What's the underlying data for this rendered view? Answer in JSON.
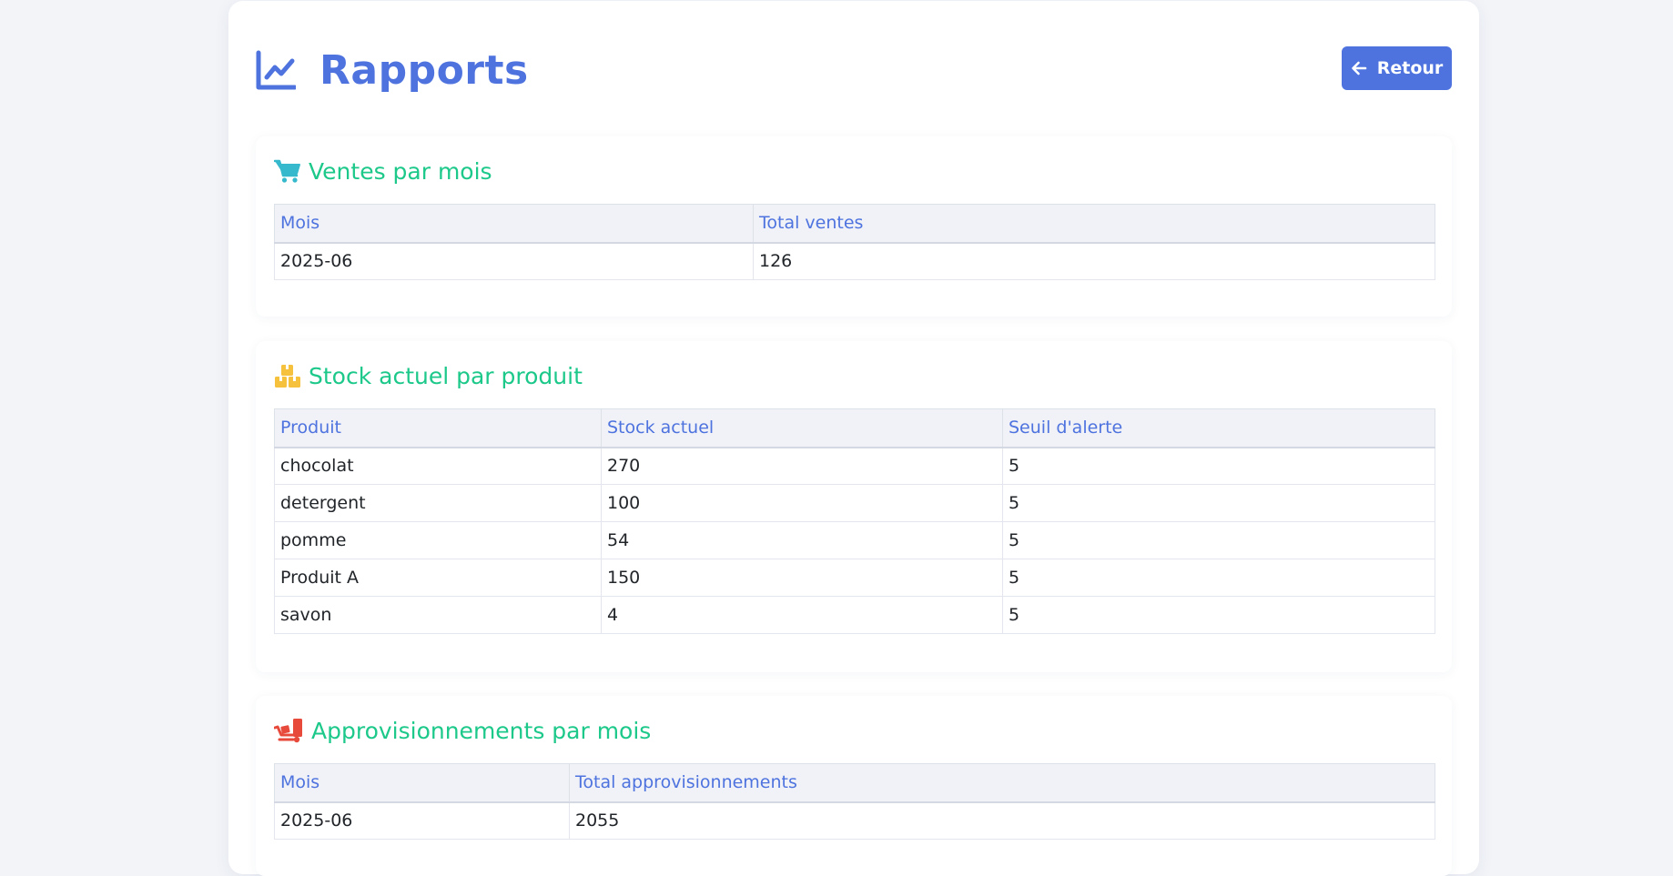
{
  "header": {
    "title": "Rapports",
    "title_icon": "line-chart-icon",
    "back_label": "Retour",
    "back_icon": "arrow-left-icon"
  },
  "colors": {
    "primary": "#4e73df",
    "section_title": "#1cc88a",
    "cart_icon": "#36b9cc",
    "boxes_icon": "#f6c23e",
    "truck_icon": "#e74a3b",
    "background": "#f2f4f8"
  },
  "sales": {
    "title": "Ventes par mois",
    "icon": "shopping-cart-icon",
    "columns": [
      "Mois",
      "Total ventes"
    ],
    "rows": [
      [
        "2025-06",
        "126"
      ]
    ]
  },
  "stock": {
    "title": "Stock actuel par produit",
    "icon": "boxes-icon",
    "columns": [
      "Produit",
      "Stock actuel",
      "Seuil d'alerte"
    ],
    "rows": [
      [
        "chocolat",
        "270",
        "5"
      ],
      [
        "detergent",
        "100",
        "5"
      ],
      [
        "pomme",
        "54",
        "5"
      ],
      [
        "Produit A",
        "150",
        "5"
      ],
      [
        "savon",
        "4",
        "5"
      ]
    ]
  },
  "supply": {
    "title": "Approvisionnements par mois",
    "icon": "truck-loading-icon",
    "columns": [
      "Mois",
      "Total approvisionnements"
    ],
    "rows": [
      [
        "2025-06",
        "2055"
      ]
    ]
  }
}
